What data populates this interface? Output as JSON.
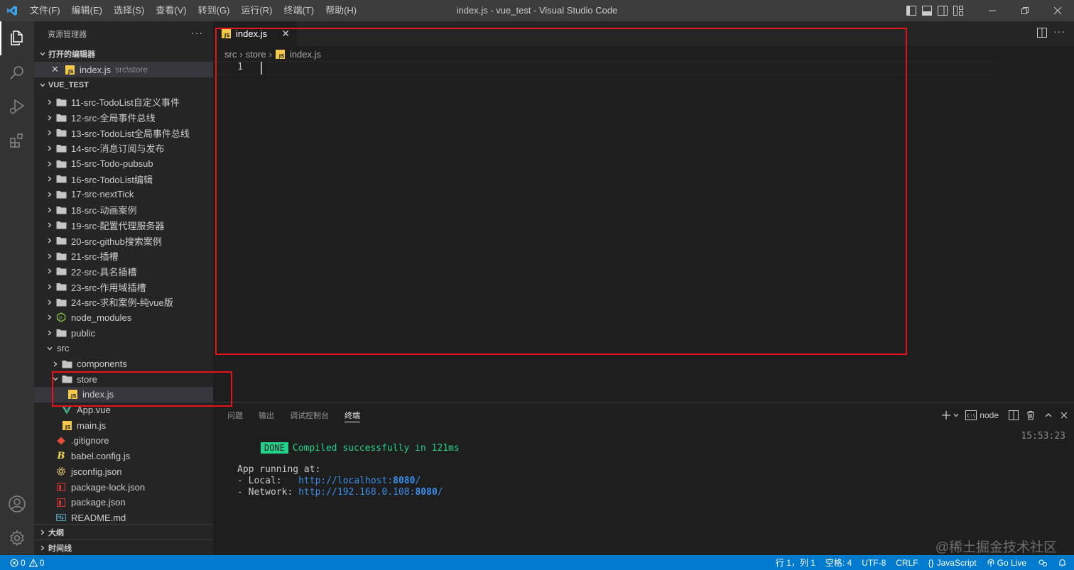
{
  "window": {
    "title": "index.js - vue_test - Visual Studio Code",
    "menu": [
      "文件(F)",
      "编辑(E)",
      "选择(S)",
      "查看(V)",
      "转到(G)",
      "运行(R)",
      "终端(T)",
      "帮助(H)"
    ]
  },
  "sidebar": {
    "title": "资源管理器",
    "more": "···",
    "open_editors_label": "打开的编辑器",
    "open_editor": {
      "name": "index.js",
      "path": "src\\store"
    },
    "project_label": "VUE_TEST",
    "tree": [
      {
        "name": "11-src-TodoList自定义事件",
        "kind": "folder",
        "level": 0,
        "state": "collapsed"
      },
      {
        "name": "12-src-全局事件总线",
        "kind": "folder",
        "level": 0,
        "state": "collapsed"
      },
      {
        "name": "13-src-TodoList全局事件总线",
        "kind": "folder",
        "level": 0,
        "state": "collapsed"
      },
      {
        "name": "14-src-消息订阅与发布",
        "kind": "folder",
        "level": 0,
        "state": "collapsed"
      },
      {
        "name": "15-src-Todo-pubsub",
        "kind": "folder",
        "level": 0,
        "state": "collapsed"
      },
      {
        "name": "16-src-TodoList编辑",
        "kind": "folder",
        "level": 0,
        "state": "collapsed"
      },
      {
        "name": "17-src-nextTick",
        "kind": "folder",
        "level": 0,
        "state": "collapsed"
      },
      {
        "name": "18-src-动画案例",
        "kind": "folder",
        "level": 0,
        "state": "collapsed"
      },
      {
        "name": "19-src-配置代理服务器",
        "kind": "folder",
        "level": 0,
        "state": "collapsed"
      },
      {
        "name": "20-src-github搜索案例",
        "kind": "folder",
        "level": 0,
        "state": "collapsed"
      },
      {
        "name": "21-src-插槽",
        "kind": "folder",
        "level": 0,
        "state": "collapsed"
      },
      {
        "name": "22-src-具名插槽",
        "kind": "folder",
        "level": 0,
        "state": "collapsed"
      },
      {
        "name": "23-src-作用域插槽",
        "kind": "folder",
        "level": 0,
        "state": "collapsed"
      },
      {
        "name": "24-src-求和案例-纯vue版",
        "kind": "folder",
        "level": 0,
        "state": "collapsed"
      },
      {
        "name": "node_modules",
        "kind": "node",
        "level": 0,
        "state": "collapsed"
      },
      {
        "name": "public",
        "kind": "folder",
        "level": 0,
        "state": "collapsed"
      },
      {
        "name": "src",
        "kind": "none",
        "level": 0,
        "state": "expanded"
      },
      {
        "name": "components",
        "kind": "folder",
        "level": 1,
        "state": "collapsed"
      },
      {
        "name": "store",
        "kind": "folder",
        "level": 1,
        "state": "expanded"
      },
      {
        "name": "index.js",
        "kind": "js",
        "level": 2,
        "state": "file",
        "selected": true
      },
      {
        "name": "App.vue",
        "kind": "vue",
        "level": 1,
        "state": "file"
      },
      {
        "name": "main.js",
        "kind": "js",
        "level": 1,
        "state": "file"
      },
      {
        "name": ".gitignore",
        "kind": "git",
        "level": 0,
        "state": "file"
      },
      {
        "name": "babel.config.js",
        "kind": "babel",
        "level": 0,
        "state": "file"
      },
      {
        "name": "jsconfig.json",
        "kind": "jsconfig",
        "level": 0,
        "state": "file"
      },
      {
        "name": "package-lock.json",
        "kind": "npm",
        "level": 0,
        "state": "file"
      },
      {
        "name": "package.json",
        "kind": "npm",
        "level": 0,
        "state": "file"
      },
      {
        "name": "README.md",
        "kind": "md",
        "level": 0,
        "state": "file"
      }
    ],
    "outline_label": "大纲",
    "timeline_label": "时间线"
  },
  "editor": {
    "tab_label": "index.js",
    "breadcrumb": [
      "src",
      "store",
      "index.js"
    ],
    "line_number": "1"
  },
  "panel": {
    "tabs": [
      "问题",
      "输出",
      "调试控制台",
      "终端"
    ],
    "active_tab": "终端",
    "shell": "node",
    "terminal": {
      "done_badge": "DONE",
      "compiled": "Compiled successfully in 121ms",
      "time": "15:53:23",
      "app_running": "App running at:",
      "local_label": "- Local:   ",
      "local_url": "http://localhost:",
      "local_port": "8080",
      "local_tail": "/",
      "network_label": "- Network: ",
      "network_url": "http://192.168.0.108:",
      "network_port": "8080",
      "network_tail": "/"
    }
  },
  "statusbar": {
    "errors": "0",
    "warnings": "0",
    "position": "行 1，列 1",
    "spaces": "空格: 4",
    "encoding": "UTF-8",
    "eol": "CRLF",
    "language": "JavaScript",
    "golive": "Go Live"
  },
  "watermark": "@稀土掘金技术社区",
  "colors": {
    "accent": "#007acc",
    "annotation": "#e3151a",
    "success": "#23d18b",
    "link": "#3b8eea"
  }
}
